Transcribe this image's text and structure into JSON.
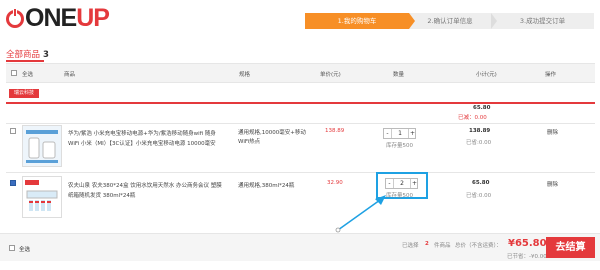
{
  "logo": {
    "part1": "ONE",
    "part2": "UP"
  },
  "steps": [
    "1.我的购物车",
    "2.确认订单信息",
    "3.成功提交订单"
  ],
  "cart": {
    "title": "全部商品",
    "count": "3"
  },
  "header": {
    "select_all": "全选",
    "product": "商品",
    "spec": "规格",
    "price": "单价(元)",
    "qty": "数量",
    "subtotal": "小计(元)",
    "action": "操作"
  },
  "store": {
    "name": "瑞云科技",
    "total": "65.80",
    "saved": "已减：0.00"
  },
  "items": [
    {
      "name": "华为/紫浩 小米充电宝移动电源+华为/紫浩移动随身wifi 随身WiFi 小米（MI）【3C认证】小米充电宝移动电源 10000毫安",
      "spec": "通用规格,10000毫安+移动WiFi热点",
      "price": "138.89",
      "qty": "1",
      "stock": "库存量500",
      "subtotal": "138.89",
      "saved": "已省:0.00",
      "delete": "删除",
      "checked": false
    },
    {
      "name": "农夫山泉 农夫380*24盒 饮用水饮用天然水 办公商务会议 塑膜纸箱随机发货 380ml*24瓶",
      "spec": "通用规格,380ml*24瓶",
      "price": "32.90",
      "qty": "2",
      "stock": "库存量500",
      "subtotal": "65.80",
      "saved": "已省:0.00",
      "delete": "删除",
      "checked": true
    }
  ],
  "footer": {
    "select_all": "全选",
    "selected_prefix": "已选择",
    "selected_count": "2",
    "selected_suffix": "件商品",
    "total_label": "总价（不含运费）：",
    "total": "¥65.80",
    "saved": "已节省：-¥0.00",
    "checkout": "去结算"
  },
  "colors": {
    "accent": "#e4393c",
    "step_active": "#f78f26",
    "highlight": "#1ea1e3"
  }
}
